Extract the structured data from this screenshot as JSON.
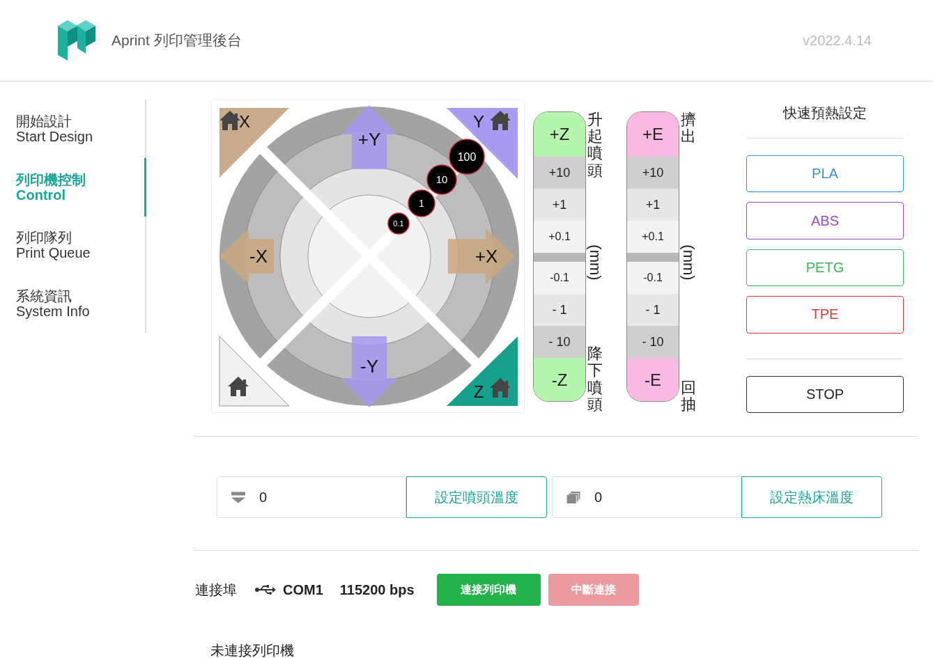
{
  "header": {
    "title": "Aprint 列印管理後台",
    "version": "v2022.4.14"
  },
  "sidebar": {
    "items": [
      {
        "zh": "開始設計",
        "en": "Start Design",
        "selected": false
      },
      {
        "zh": "列印機控制",
        "en": "Control",
        "selected": true
      },
      {
        "zh": "列印隊列",
        "en": "Print Queue",
        "selected": false
      },
      {
        "zh": "系統資訊",
        "en": "System Info",
        "selected": false
      }
    ]
  },
  "jog": {
    "home_buttons": [
      {
        "kind": "x",
        "label": "X"
      },
      {
        "kind": "y",
        "label": "Y"
      },
      {
        "kind": "all"
      },
      {
        "kind": "z",
        "label": "Z"
      }
    ],
    "arrows": [
      {
        "kind": "up",
        "label": "+Y"
      },
      {
        "kind": "left",
        "label": "-X"
      },
      {
        "kind": "right",
        "label": "+X"
      },
      {
        "kind": "down",
        "label": "-Y"
      }
    ],
    "steps": [
      "0.1",
      "1",
      "10",
      "100"
    ]
  },
  "axis_columns": [
    {
      "kind": "z",
      "top_label": "升起噴頭",
      "unit": "(mm)",
      "bottom_label": "降下噴頭",
      "buttons": [
        "+Z",
        "+10",
        "+1",
        "+0.1",
        "-0.1",
        "- 1",
        "- 10",
        "-Z"
      ]
    },
    {
      "kind": "e",
      "top_label": "擠出",
      "unit": "(mm)",
      "bottom_label": "回抽",
      "buttons": [
        "+E",
        "+10",
        "+1",
        "+0.1",
        "-0.1",
        "- 1",
        "- 10",
        "-E"
      ]
    }
  ],
  "preheat": {
    "title": "快速預熱設定",
    "presets": [
      {
        "label": "PLA",
        "color": "#3b8fd4"
      },
      {
        "label": "ABS",
        "color": "#9a4cc4"
      },
      {
        "label": "PETG",
        "color": "#3cb45a"
      },
      {
        "label": "TPE",
        "color": "#d33a3a"
      }
    ],
    "stop": "STOP"
  },
  "temperature": [
    {
      "kind": "nozzle",
      "value": "0",
      "button": "設定噴頭溫度"
    },
    {
      "kind": "bed",
      "value": "0",
      "button": "設定熱床溫度"
    }
  ],
  "connection": {
    "label": "連接埠",
    "port": "COM1",
    "baud": "115200 bps",
    "connect": {
      "label": "連接列印機",
      "disabled": false
    },
    "disconnect": {
      "label": "中斷連接",
      "disabled": true
    }
  },
  "status": "未連接列印機"
}
